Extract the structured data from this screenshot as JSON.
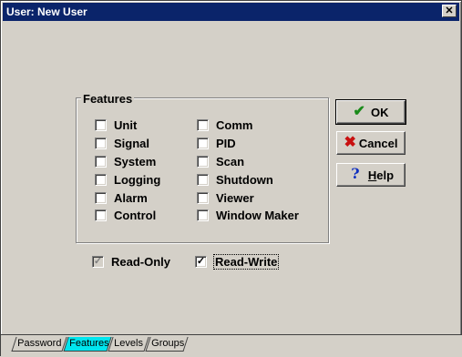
{
  "window": {
    "title": "User: New User",
    "close_glyph": "✕"
  },
  "features_group": {
    "legend": "Features",
    "left_column": [
      "Unit",
      "Signal",
      "System",
      "Logging",
      "Alarm",
      "Control"
    ],
    "right_column": [
      "Comm",
      "PID",
      "Scan",
      "Shutdown",
      "Viewer",
      "Window Maker"
    ]
  },
  "access": {
    "read_only": {
      "label": "Read-Only",
      "checked": true,
      "enabled": false
    },
    "read_write": {
      "label": "Read-Write",
      "checked": true,
      "enabled": true
    }
  },
  "buttons": {
    "ok": {
      "label": "OK",
      "icon": "checkmark-icon",
      "icon_color": "#1a8a1a"
    },
    "cancel": {
      "label": "Cancel",
      "icon": "x-icon",
      "icon_color": "#c81010"
    },
    "help": {
      "label_underlined": "H",
      "label_rest": "elp",
      "icon": "question-icon",
      "icon_color": "#1030c0"
    }
  },
  "tabs": [
    {
      "label": "Password",
      "active": false
    },
    {
      "label": "Features",
      "active": true
    },
    {
      "label": "Levels",
      "active": false
    },
    {
      "label": "Groups",
      "active": false
    }
  ],
  "colors": {
    "titlebar": "#0a246a",
    "face": "#d4d0c8",
    "active_tab": "#00e5ee"
  }
}
